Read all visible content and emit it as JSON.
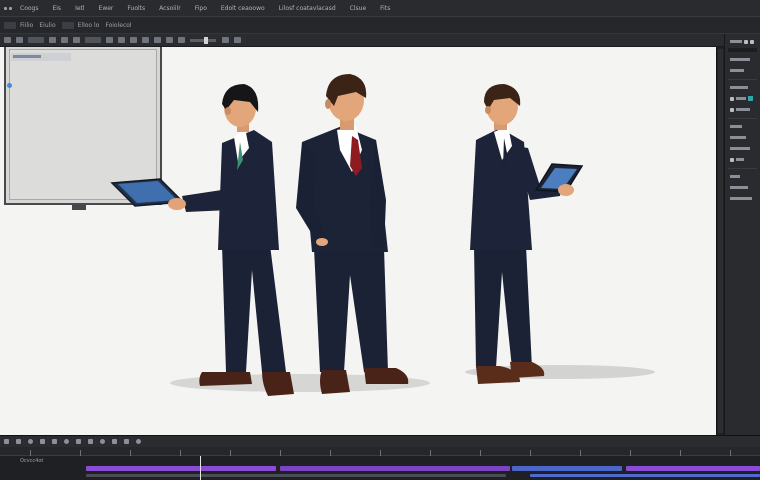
{
  "menubar": {
    "items": [
      "Coogs",
      "Eis",
      "Ietl",
      "Ewer",
      "Fuolts",
      "Acsoiilr",
      "Fipo",
      "Edolt ceaoowo",
      "Lilosf coatavlacasd",
      "Clsue",
      "Fits"
    ]
  },
  "toolbar2": {
    "items": [
      "Fiilio",
      "Eiulio",
      "Elloo lo",
      "Foiolecol"
    ]
  },
  "timeline": {
    "label": "Ocvcc4ot"
  },
  "colors": {
    "canvas_bg": "#f4f4f3",
    "suit": "#1b2236",
    "tie": "#8e1b22",
    "timeline_purple": "#8a4bd6",
    "timeline_blue": "#4b66c8",
    "panel_teal": "#2fa6a8"
  },
  "icons": [
    "scene-men-with-tablets-illustration",
    "whiteboard-graphic",
    "panel-toggle-icons",
    "timeline-tracks"
  ]
}
